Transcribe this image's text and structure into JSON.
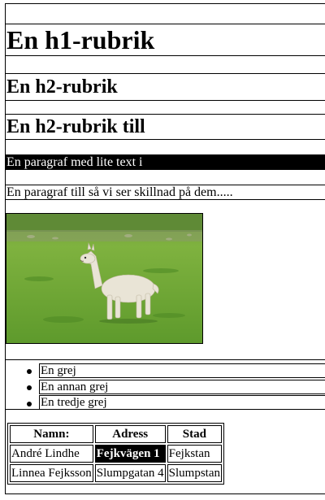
{
  "headings": {
    "h1": "En h1-rubrik",
    "h2_first": "En h2-rubrik",
    "h2_second": "En h2-rubrik till"
  },
  "paragraphs": {
    "highlighted": "En paragraf med lite text i",
    "plain": "En paragraf till så vi ser skillnad på dem....."
  },
  "list": {
    "items": [
      "En grej",
      "En annan grej",
      "En tredje grej"
    ]
  },
  "table": {
    "headers": [
      "Namn:",
      "Adress",
      "Stad"
    ],
    "rows": [
      [
        "André Lindhe",
        "Fejkvägen 1",
        "Fejkstan"
      ],
      [
        "Linnea Fejksson",
        "Slumpgatan 4",
        "Slumpstan"
      ]
    ]
  },
  "colors": {
    "text": "#000000",
    "background": "#ffffff",
    "highlight_background": "#000000",
    "highlight_text": "#ffffff"
  }
}
